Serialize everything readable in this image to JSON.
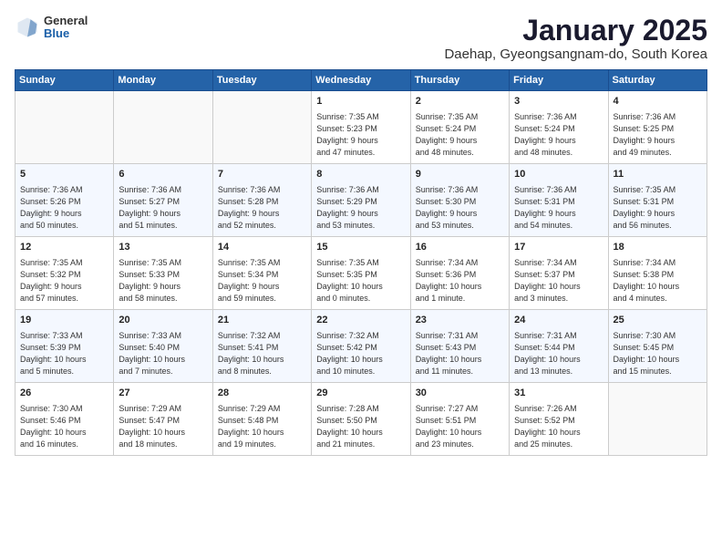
{
  "header": {
    "logo_general": "General",
    "logo_blue": "Blue",
    "month_year": "January 2025",
    "location": "Daehap, Gyeongsangnam-do, South Korea"
  },
  "days_of_week": [
    "Sunday",
    "Monday",
    "Tuesday",
    "Wednesday",
    "Thursday",
    "Friday",
    "Saturday"
  ],
  "weeks": [
    [
      {
        "day": "",
        "info": ""
      },
      {
        "day": "",
        "info": ""
      },
      {
        "day": "",
        "info": ""
      },
      {
        "day": "1",
        "info": "Sunrise: 7:35 AM\nSunset: 5:23 PM\nDaylight: 9 hours\nand 47 minutes."
      },
      {
        "day": "2",
        "info": "Sunrise: 7:35 AM\nSunset: 5:24 PM\nDaylight: 9 hours\nand 48 minutes."
      },
      {
        "day": "3",
        "info": "Sunrise: 7:36 AM\nSunset: 5:24 PM\nDaylight: 9 hours\nand 48 minutes."
      },
      {
        "day": "4",
        "info": "Sunrise: 7:36 AM\nSunset: 5:25 PM\nDaylight: 9 hours\nand 49 minutes."
      }
    ],
    [
      {
        "day": "5",
        "info": "Sunrise: 7:36 AM\nSunset: 5:26 PM\nDaylight: 9 hours\nand 50 minutes."
      },
      {
        "day": "6",
        "info": "Sunrise: 7:36 AM\nSunset: 5:27 PM\nDaylight: 9 hours\nand 51 minutes."
      },
      {
        "day": "7",
        "info": "Sunrise: 7:36 AM\nSunset: 5:28 PM\nDaylight: 9 hours\nand 52 minutes."
      },
      {
        "day": "8",
        "info": "Sunrise: 7:36 AM\nSunset: 5:29 PM\nDaylight: 9 hours\nand 53 minutes."
      },
      {
        "day": "9",
        "info": "Sunrise: 7:36 AM\nSunset: 5:30 PM\nDaylight: 9 hours\nand 53 minutes."
      },
      {
        "day": "10",
        "info": "Sunrise: 7:36 AM\nSunset: 5:31 PM\nDaylight: 9 hours\nand 54 minutes."
      },
      {
        "day": "11",
        "info": "Sunrise: 7:35 AM\nSunset: 5:31 PM\nDaylight: 9 hours\nand 56 minutes."
      }
    ],
    [
      {
        "day": "12",
        "info": "Sunrise: 7:35 AM\nSunset: 5:32 PM\nDaylight: 9 hours\nand 57 minutes."
      },
      {
        "day": "13",
        "info": "Sunrise: 7:35 AM\nSunset: 5:33 PM\nDaylight: 9 hours\nand 58 minutes."
      },
      {
        "day": "14",
        "info": "Sunrise: 7:35 AM\nSunset: 5:34 PM\nDaylight: 9 hours\nand 59 minutes."
      },
      {
        "day": "15",
        "info": "Sunrise: 7:35 AM\nSunset: 5:35 PM\nDaylight: 10 hours\nand 0 minutes."
      },
      {
        "day": "16",
        "info": "Sunrise: 7:34 AM\nSunset: 5:36 PM\nDaylight: 10 hours\nand 1 minute."
      },
      {
        "day": "17",
        "info": "Sunrise: 7:34 AM\nSunset: 5:37 PM\nDaylight: 10 hours\nand 3 minutes."
      },
      {
        "day": "18",
        "info": "Sunrise: 7:34 AM\nSunset: 5:38 PM\nDaylight: 10 hours\nand 4 minutes."
      }
    ],
    [
      {
        "day": "19",
        "info": "Sunrise: 7:33 AM\nSunset: 5:39 PM\nDaylight: 10 hours\nand 5 minutes."
      },
      {
        "day": "20",
        "info": "Sunrise: 7:33 AM\nSunset: 5:40 PM\nDaylight: 10 hours\nand 7 minutes."
      },
      {
        "day": "21",
        "info": "Sunrise: 7:32 AM\nSunset: 5:41 PM\nDaylight: 10 hours\nand 8 minutes."
      },
      {
        "day": "22",
        "info": "Sunrise: 7:32 AM\nSunset: 5:42 PM\nDaylight: 10 hours\nand 10 minutes."
      },
      {
        "day": "23",
        "info": "Sunrise: 7:31 AM\nSunset: 5:43 PM\nDaylight: 10 hours\nand 11 minutes."
      },
      {
        "day": "24",
        "info": "Sunrise: 7:31 AM\nSunset: 5:44 PM\nDaylight: 10 hours\nand 13 minutes."
      },
      {
        "day": "25",
        "info": "Sunrise: 7:30 AM\nSunset: 5:45 PM\nDaylight: 10 hours\nand 15 minutes."
      }
    ],
    [
      {
        "day": "26",
        "info": "Sunrise: 7:30 AM\nSunset: 5:46 PM\nDaylight: 10 hours\nand 16 minutes."
      },
      {
        "day": "27",
        "info": "Sunrise: 7:29 AM\nSunset: 5:47 PM\nDaylight: 10 hours\nand 18 minutes."
      },
      {
        "day": "28",
        "info": "Sunrise: 7:29 AM\nSunset: 5:48 PM\nDaylight: 10 hours\nand 19 minutes."
      },
      {
        "day": "29",
        "info": "Sunrise: 7:28 AM\nSunset: 5:50 PM\nDaylight: 10 hours\nand 21 minutes."
      },
      {
        "day": "30",
        "info": "Sunrise: 7:27 AM\nSunset: 5:51 PM\nDaylight: 10 hours\nand 23 minutes."
      },
      {
        "day": "31",
        "info": "Sunrise: 7:26 AM\nSunset: 5:52 PM\nDaylight: 10 hours\nand 25 minutes."
      },
      {
        "day": "",
        "info": ""
      }
    ]
  ]
}
